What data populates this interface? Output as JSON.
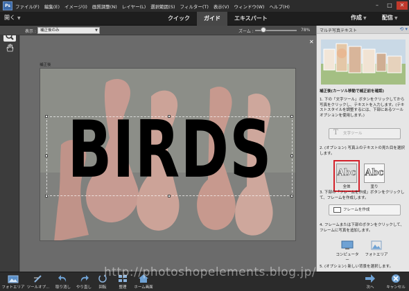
{
  "app": {
    "logo_text": "Ps"
  },
  "menu": [
    "ファイル(F)",
    "編集(E)",
    "イメージ(I)",
    "画質調整(N)",
    "レイヤー(L)",
    "選択範囲(S)",
    "フィルター(T)",
    "表示(V)",
    "ウィンドウ(W)",
    "ヘルプ(H)"
  ],
  "modebar": {
    "open_label": "開く",
    "tabs": [
      "クイック",
      "ガイド",
      "エキスパート"
    ],
    "active_tab": "ガイド",
    "create_label": "作成",
    "share_label": "配信"
  },
  "options": {
    "view_label": "表示 :",
    "view_value": "補正後のみ",
    "zoom_label": "ズーム :",
    "zoom_value": "78%",
    "zoom_level": 0.2
  },
  "canvas": {
    "caption": "補正後",
    "text": "BIRDS"
  },
  "panel": {
    "title": "マルチ写真テキスト",
    "subtitle": "補正後(カーソル移動で補正前を確認)",
    "step1": "1. 下の「文字ツール」ボタンをクリックしてから写真をクリックし、テキストを入力します。(テキストスタイルを調整するには、下部にあるツールオプションを使用します。)",
    "text_tool_button": "文字ツール",
    "step2": "2. (オプション) 写真上のテキストの見た目を選択します。",
    "option_full": "全体",
    "option_fill": "塗り",
    "step3": "3. 下部の「フレームを作成」ボタンをクリックして、フレームを作成します。",
    "frame_button": "フレームを作成",
    "step4": "4. フレームまたは下部のボタンをクリックして、フレームに写真を追加します。",
    "computer_label": "コンピューター",
    "photo_area_label": "フォトエリア",
    "step5": "5. (オプション) 新しい背景を選択します。"
  },
  "bottombar": {
    "items": [
      "フォトエリア",
      "ツールオプ...",
      "取り消し",
      "やり直し",
      "回転",
      "整理",
      "ホーム画面"
    ],
    "next_label": "次へ",
    "cancel_label": "キャンセル"
  },
  "watermark": "http://photoshopelements.blog.jp/",
  "colors": {
    "accent_red": "#d4202a",
    "link_blue": "#3a6ab0"
  }
}
